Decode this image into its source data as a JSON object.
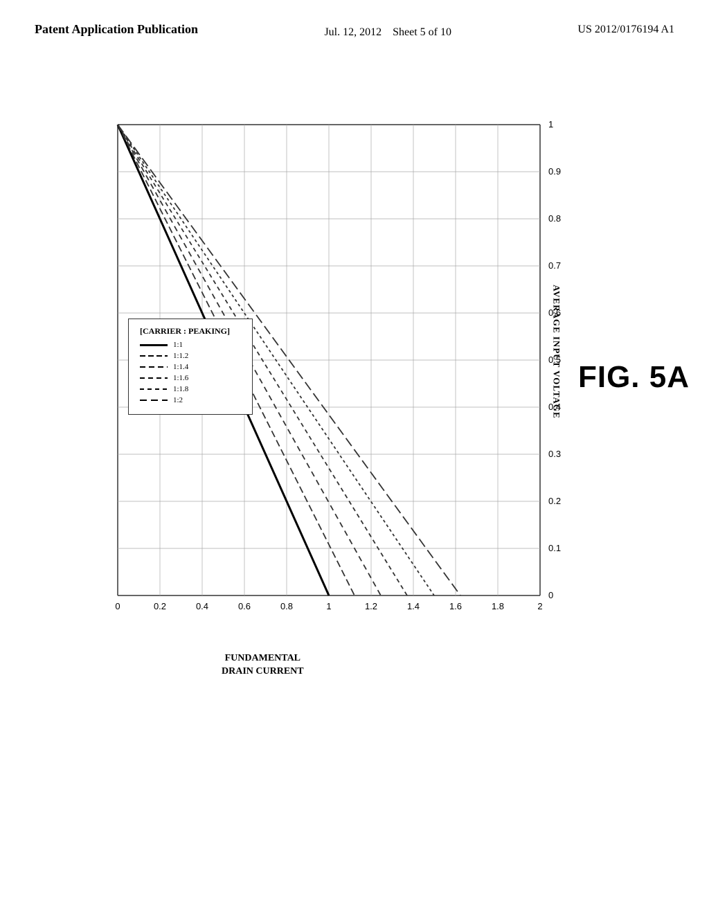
{
  "header": {
    "left_label": "Patent Application Publication",
    "center_date": "Jul. 12, 2012",
    "center_sheet": "Sheet 5 of 10",
    "right_patent": "US 2012/0176194 A1"
  },
  "figure": {
    "label": "FIG. 5A"
  },
  "chart": {
    "x_axis_label": "FUNDAMENTAL\nDRAIN CURRENT",
    "y_axis_label": "AVERAGE INPUT VOLTAGE",
    "x_ticks": [
      "0",
      "0.2",
      "0.4",
      "0.6",
      "0.8",
      "1",
      "1.2",
      "1.4",
      "1.6",
      "1.8",
      "2"
    ],
    "y_ticks": [
      "0",
      "0.1",
      "0.2",
      "0.3",
      "0.4",
      "0.5",
      "0.6",
      "0.7",
      "0.8",
      "0.9",
      "1"
    ],
    "legend_title": "[CARRIER : PEAKING]",
    "legend_items": [
      {
        "label": "1:1",
        "style": "solid-thick"
      },
      {
        "label": "1:1.2",
        "style": "dash1"
      },
      {
        "label": "1:1.4",
        "style": "dash2"
      },
      {
        "label": "1:1.6",
        "style": "dash3"
      },
      {
        "label": "1:1.8",
        "style": "dash4"
      },
      {
        "label": "1:2",
        "style": "dash5"
      }
    ]
  }
}
